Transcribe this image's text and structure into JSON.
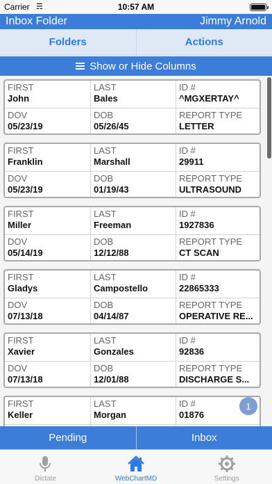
{
  "status_bar": {
    "carrier": "Carrier",
    "time": "10:57 AM"
  },
  "header": {
    "folder_title": "Inbox Folder",
    "user_name": "Jimmy Arnold"
  },
  "tabs": {
    "folders_label": "Folders",
    "actions_label": "Actions"
  },
  "columns_toggle": {
    "label": "Show or Hide Columns",
    "icon": "menu-icon"
  },
  "field_labels": {
    "first": "FIRST",
    "last": "LAST",
    "id": "ID #",
    "dov": "DOV",
    "dob": "DOB",
    "report_type": "REPORT TYPE"
  },
  "records": [
    {
      "first": "John",
      "last": "Bales",
      "id": "^MGXERTAY^",
      "dov": "05/23/19",
      "dob": "05/26/45",
      "report_type": "LETTER"
    },
    {
      "first": "Franklin",
      "last": "Marshall",
      "id": "29911",
      "dov": "05/23/19",
      "dob": "01/19/43",
      "report_type": "ULTRASOUND"
    },
    {
      "first": "Miller",
      "last": "Freeman",
      "id": "1927836",
      "dov": "05/14/19",
      "dob": "12/12/88",
      "report_type": "CT SCAN"
    },
    {
      "first": "Gladys",
      "last": "Campostello",
      "id": "22865333",
      "dov": "07/13/18",
      "dob": "04/14/87",
      "report_type": "OPERATIVE RE..."
    },
    {
      "first": "Xavier",
      "last": "Gonzales",
      "id": "92836",
      "dov": "07/13/18",
      "dob": "12/01/88",
      "report_type": "DISCHARGE S..."
    },
    {
      "first": "Keller",
      "last": "Morgan",
      "id": "01876",
      "dov": "",
      "dob": "",
      "report_type": ""
    }
  ],
  "page_badge": "1",
  "bottom_tabs": {
    "pending_label": "Pending",
    "inbox_label": "Inbox"
  },
  "tab_bar": [
    {
      "label": "Dictate",
      "icon": "microphone-icon",
      "active": false
    },
    {
      "label": "WebChartMD",
      "icon": "home-icon",
      "active": true
    },
    {
      "label": "Settings",
      "icon": "gear-icon",
      "active": false
    }
  ],
  "colors": {
    "brand_blue": "#3b7dd8",
    "tab_background": "#dfe9f5",
    "active_tab": "#2d7be0"
  }
}
